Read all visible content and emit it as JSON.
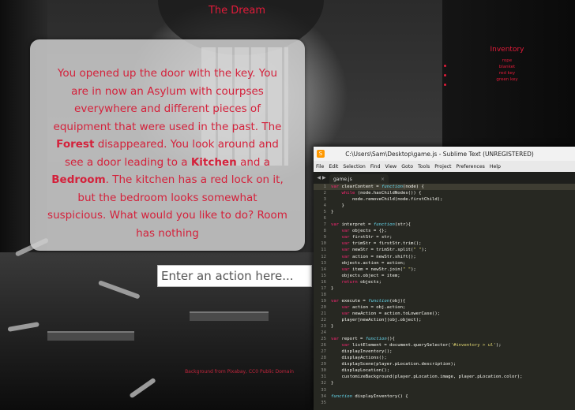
{
  "header": {
    "title": "The Dream"
  },
  "story": {
    "segments": [
      {
        "text": "You opened up the door with the key. You are in now an Asylum with courpses everywhere and different pieces of equipment that were used in the past. The ",
        "bold": false
      },
      {
        "text": "Forest",
        "bold": true
      },
      {
        "text": " disappeared. You look around and see a door leading to a ",
        "bold": false
      },
      {
        "text": "Kitchen",
        "bold": true
      },
      {
        "text": " and a ",
        "bold": false
      },
      {
        "text": "Bedroom",
        "bold": true
      },
      {
        "text": ". The kitchen has a red lock on it, but the bedroom looks somewhat suspicious. What would you like to do? Room has nothing",
        "bold": false
      }
    ]
  },
  "action_input": {
    "placeholder": "Enter an action here...",
    "value": ""
  },
  "inventory": {
    "title": "Inventory",
    "items": [
      "rope",
      "blanket",
      "red key",
      "green key"
    ]
  },
  "credit": {
    "text": "Background from Pixabay, CC0 Public Domain"
  },
  "sublime": {
    "window_title": "C:\\Users\\Sam\\Desktop\\game.js - Sublime Text (UNREGISTERED)",
    "menu": [
      "File",
      "Edit",
      "Selection",
      "Find",
      "View",
      "Goto",
      "Tools",
      "Project",
      "Preferences",
      "Help"
    ],
    "tab_label": "game.js",
    "colors": {
      "keyword": "#66d9ef",
      "storage": "#f92672",
      "function": "#a6e22e",
      "string": "#e6db74",
      "number": "#ae81ff",
      "text": "#f8f8f2"
    },
    "lines": [
      {
        "n": "1",
        "text": "var clearContent = function(node) {"
      },
      {
        "n": "2",
        "text": "    while (node.hasChildNodes()) {"
      },
      {
        "n": "3",
        "text": "        node.removeChild(node.firstChild);"
      },
      {
        "n": "4",
        "text": "    }"
      },
      {
        "n": "5",
        "text": "}"
      },
      {
        "n": "6",
        "text": ""
      },
      {
        "n": "7",
        "text": "var interpret = function(str){"
      },
      {
        "n": "8",
        "text": "    var objects = {};"
      },
      {
        "n": "9",
        "text": "    var firstStr = str;"
      },
      {
        "n": "10",
        "text": "    var trimStr = firstStr.trim();"
      },
      {
        "n": "11",
        "text": "    var newStr = trimStr.split(\" \");"
      },
      {
        "n": "12",
        "text": "    var action = newStr.shift();"
      },
      {
        "n": "13",
        "text": "    objects.action = action;"
      },
      {
        "n": "14",
        "text": "    var item = newStr.join(\" \");"
      },
      {
        "n": "15",
        "text": "    objects.object = item;"
      },
      {
        "n": "16",
        "text": "    return objects;"
      },
      {
        "n": "17",
        "text": "}"
      },
      {
        "n": "18",
        "text": ""
      },
      {
        "n": "19",
        "text": "var execute = function(obj){"
      },
      {
        "n": "20",
        "text": "    var action = obj.action;"
      },
      {
        "n": "21",
        "text": "    var newAction = action.toLowerCase();"
      },
      {
        "n": "22",
        "text": "    player[newAction](obj.object);"
      },
      {
        "n": "23",
        "text": "}"
      },
      {
        "n": "24",
        "text": ""
      },
      {
        "n": "25",
        "text": "var report = function(){"
      },
      {
        "n": "26",
        "text": "    var listElement = document.querySelector('#inventory > ul');"
      },
      {
        "n": "27",
        "text": "    displayInventory();"
      },
      {
        "n": "28",
        "text": "    displayActions();"
      },
      {
        "n": "29",
        "text": "    displayScene(player.pLocation.description);"
      },
      {
        "n": "30",
        "text": "    displayLocation();"
      },
      {
        "n": "31",
        "text": "    customizeBackground(player.pLocation.image, player.pLocation.color);"
      },
      {
        "n": "32",
        "text": "}"
      },
      {
        "n": "33",
        "text": ""
      },
      {
        "n": "34",
        "text": "function displayInventory() {"
      },
      {
        "n": "35",
        "text": ""
      }
    ]
  }
}
